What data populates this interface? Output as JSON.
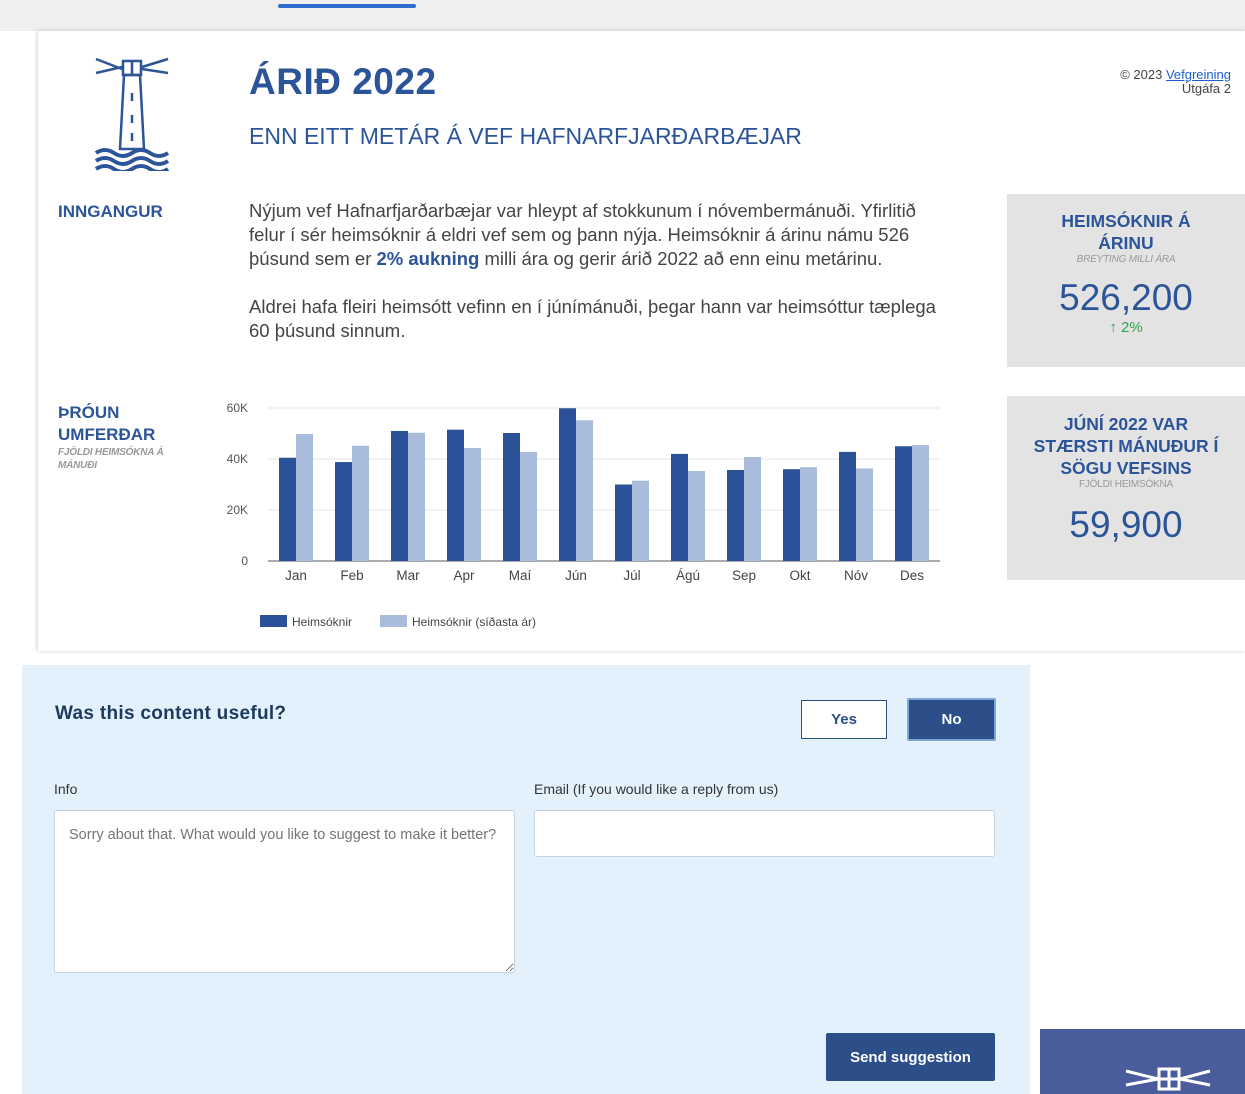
{
  "report": {
    "title": "ÁRIÐ 2022",
    "subtitle": "ENN EITT METÁR Á VEF HAFNARFJARÐARBÆJAR",
    "copyright_prefix": "© 2023 ",
    "copyright_link": "Vefgreining",
    "version": "Útgáfa 2",
    "intro_label": "INNGANGUR",
    "intro_p1_a": "Nýjum vef Hafnarfjarðarbæjar var hleypt af stokkunum í nóvembermánuði. Yfirlitið felur í sér heimsóknir á eldri vef sem og þann nýja. Heimsóknir á árinu námu 526 þúsund sem er ",
    "intro_p1_highlight": "2% aukning",
    "intro_p1_b": " milli ára og gerir árið 2022 að enn einu metárinu.",
    "intro_p2": "Aldrei hafa fleiri heimsótt vefinn en í júnímánuði, þegar hann var heimsóttur tæplega 60 þúsund sinnum.",
    "traffic_label_1": "ÞRÓUN",
    "traffic_label_2": "UMFERÐAR",
    "traffic_sub": "FJÖLDI HEIMSÓKNA Á MÁNUÐI"
  },
  "kpi1": {
    "title": "HEIMSÓKNIR Á ÁRINU",
    "sub": "BREYTING MILLI ÁRA",
    "value": "526,200",
    "change": "↑ 2%"
  },
  "kpi2": {
    "title": "JÚNÍ 2022 VAR STÆRSTI MÁNUÐUR Í SÖGU VEFSINS",
    "sub": "FJÖLDI HEIMSÓKNA",
    "value": "59,900"
  },
  "chart_data": {
    "type": "bar",
    "categories": [
      "Jan",
      "Feb",
      "Mar",
      "Apr",
      "Maí",
      "Jún",
      "Júl",
      "Ágú",
      "Sep",
      "Okt",
      "Nóv",
      "Des"
    ],
    "series": [
      {
        "name": "Heimsóknir",
        "color": "#2b5299",
        "values": [
          40500,
          38800,
          51000,
          51500,
          50200,
          59900,
          30000,
          42000,
          35700,
          36000,
          42800,
          45000
        ]
      },
      {
        "name": "Heimsóknir (síðasta ár)",
        "color": "#a9bcdc",
        "values": [
          49800,
          45200,
          50300,
          44300,
          42800,
          55200,
          31500,
          35300,
          40800,
          36800,
          36300,
          45500
        ]
      }
    ],
    "ylim": [
      0,
      60000
    ],
    "yticks": [
      0,
      20000,
      40000,
      60000
    ],
    "ytick_labels": [
      "0",
      "20K",
      "40K",
      "60K"
    ],
    "grid": true,
    "legend_position": "bottom-left"
  },
  "feedback": {
    "question": "Was this content useful?",
    "yes_label": "Yes",
    "no_label": "No",
    "info_label": "Info",
    "info_placeholder": "Sorry about that. What would you like to suggest to make it better?",
    "email_label": "Email (If you would like a reply from us)",
    "email_value": "",
    "send_label": "Send suggestion"
  }
}
